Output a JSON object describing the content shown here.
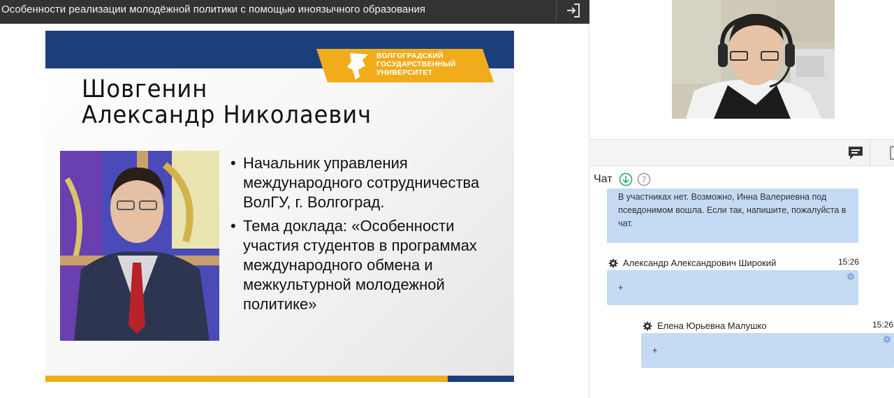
{
  "window": {
    "title": "Особенности реализации молодёжной политики с помощью иноязычного образования",
    "exit_icon": "exit-icon"
  },
  "slide": {
    "name_line1": "Шовгенин",
    "name_line2": "Александр Николаевич",
    "logo_line1": "ВОЛГОГРАДСКИЙ",
    "logo_line2": "ГОСУДАРСТВЕННЫЙ",
    "logo_line3": "УНИВЕРСИТЕТ",
    "bullets": [
      "Начальник управления международного сотрудничества ВолГУ, г. Волгоград.",
      "Тема доклада: «Особенности участия студентов в программах международного обмена и межкультурной молодежной политике»"
    ],
    "colors": {
      "navy": "#1c3f7c",
      "gold": "#f1ac1c"
    }
  },
  "chat": {
    "title": "Чат",
    "header_icons": [
      "download-icon",
      "help-icon"
    ],
    "messages": [
      {
        "author": "",
        "time": "",
        "text": "В участниках нет. Возможно, Инна Валериевна под псевдонимом вошла. Если так, напишите, пожалуйста в чат."
      },
      {
        "author": "Александр Александрович Широкий",
        "time": "15:26",
        "text": "+"
      },
      {
        "author": "Елена Юрьевна Малушко",
        "time": "15:26",
        "text": "+"
      }
    ],
    "colors": {
      "bubble": "#c5daf3",
      "accent": "#2aaa6a"
    }
  }
}
